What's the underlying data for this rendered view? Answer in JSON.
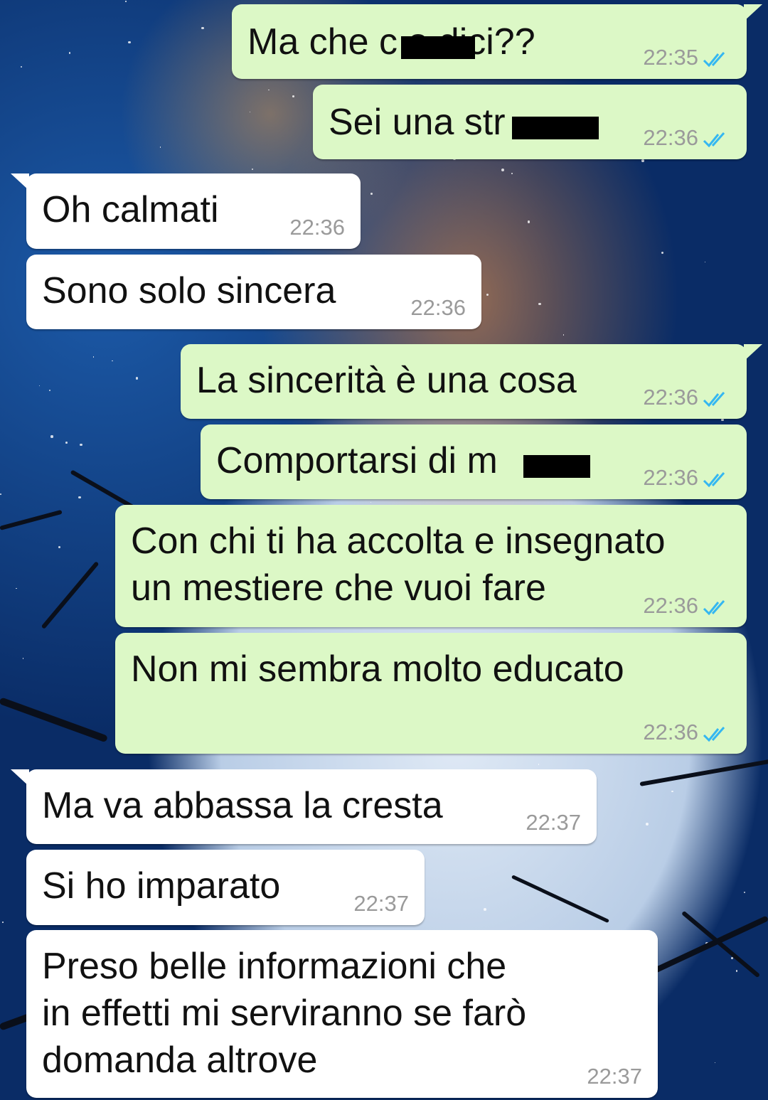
{
  "colors": {
    "outgoing_bubble": "#dcf8c6",
    "incoming_bubble": "#ffffff",
    "timestamp": "#9a9a9a",
    "read_ticks": "#34b7f1"
  },
  "messages": [
    {
      "dir": "out",
      "text": "Ma che c     o dici??",
      "time": "22:35",
      "read": true,
      "redacted": true
    },
    {
      "dir": "out",
      "text": "Sei una str",
      "time": "22:36",
      "read": true,
      "redacted": true
    },
    {
      "dir": "in",
      "text": "Oh calmati",
      "time": "22:36"
    },
    {
      "dir": "in",
      "text": "Sono solo sincera",
      "time": "22:36"
    },
    {
      "dir": "out",
      "text": "La sincerità è una cosa",
      "time": "22:36",
      "read": true
    },
    {
      "dir": "out",
      "text": "Comportarsi di m",
      "time": "22:36",
      "read": true,
      "redacted": true
    },
    {
      "dir": "out",
      "text": "Con chi ti ha accolta e insegnato\nun mestiere che vuoi fare",
      "time": "22:36",
      "read": true
    },
    {
      "dir": "out",
      "text": "Non mi sembra molto educato",
      "time": "22:36",
      "read": true
    },
    {
      "dir": "in",
      "text": "Ma va abbassa la cresta",
      "time": "22:37"
    },
    {
      "dir": "in",
      "text": "Si ho imparato",
      "time": "22:37"
    },
    {
      "dir": "in",
      "text": "Preso belle informazioni che\nin effetti mi serviranno se farò\ndomanda altrove",
      "time": "22:37"
    }
  ]
}
